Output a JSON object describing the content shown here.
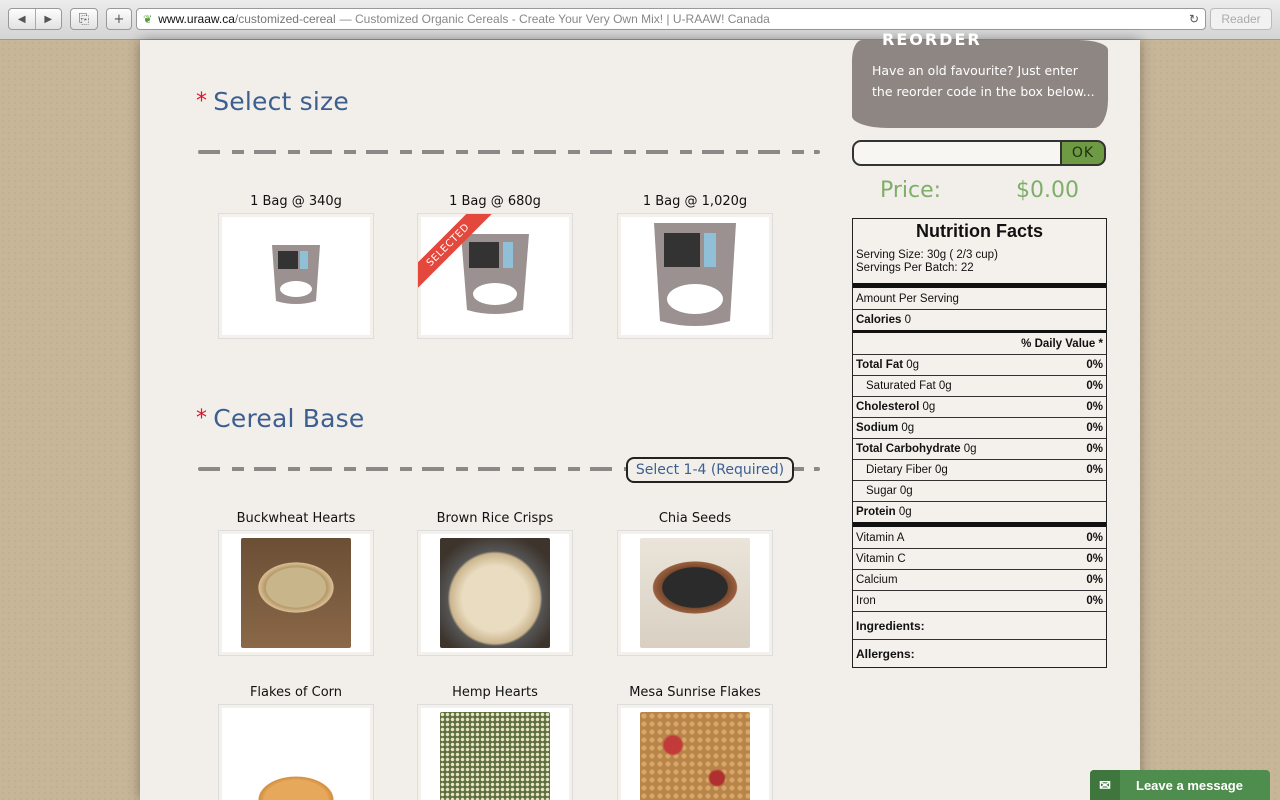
{
  "browser": {
    "url_host": "www.uraaw.ca",
    "url_path": "/customized-cereal",
    "page_title": " — Customized Organic Cereals - Create Your Very Own Mix! | U-RAAW! Canada",
    "reader_label": "Reader",
    "back_glyph": "◀",
    "forward_glyph": "▶",
    "share_glyph": "⎘",
    "add_glyph": "+",
    "reload_glyph": "↻"
  },
  "size_section": {
    "star": "*",
    "title": "Select size",
    "options": [
      {
        "label": "1 Bag @ 340g",
        "selected": false
      },
      {
        "label": "1 Bag @ 680g",
        "selected": true,
        "ribbon": "SELECTED"
      },
      {
        "label": "1 Bag @ 1,020g",
        "selected": false
      }
    ]
  },
  "base_section": {
    "star": "*",
    "title": "Cereal Base",
    "requirement": "Select 1-4 (Required)",
    "items": [
      {
        "label": "Buckwheat Hearts"
      },
      {
        "label": "Brown Rice Crisps"
      },
      {
        "label": "Chia Seeds"
      },
      {
        "label": "Flakes of Corn"
      },
      {
        "label": "Hemp Hearts"
      },
      {
        "label": "Mesa Sunrise Flakes"
      }
    ]
  },
  "reorder": {
    "title": "REORDER",
    "text": "Have an old favourite? Just enter the reorder code in the box below...",
    "input_value": "",
    "ok_label": "OK"
  },
  "price": {
    "label": "Price:",
    "value": "$0.00"
  },
  "nutrition": {
    "title": "Nutrition Facts",
    "serving_size": "Serving Size: 30g ( 2/3 cup)",
    "servings": "Servings Per Batch: 22",
    "amount_per": "Amount Per Serving",
    "calories_label": "Calories",
    "calories_value": "0",
    "daily_value": "% Daily Value *",
    "rows": [
      {
        "label": "Total Fat",
        "amount": "0g",
        "pct": "0%"
      },
      {
        "label": "Saturated Fat",
        "amount": "0g",
        "pct": "0%"
      },
      {
        "label": "Cholesterol",
        "amount": "0g",
        "pct": "0%"
      },
      {
        "label": "Sodium",
        "amount": "0g",
        "pct": "0%"
      },
      {
        "label": "Total Carbohydrate",
        "amount": "0g",
        "pct": "0%"
      },
      {
        "label": "Dietary Fiber",
        "amount": "0g",
        "pct": "0%"
      },
      {
        "label": "Sugar",
        "amount": "0g",
        "pct": ""
      },
      {
        "label": "Protein",
        "amount": "0g",
        "pct": ""
      }
    ],
    "vitamins": [
      {
        "label": "Vitamin A",
        "pct": "0%"
      },
      {
        "label": "Vitamin C",
        "pct": "0%"
      },
      {
        "label": "Calcium",
        "pct": "0%"
      },
      {
        "label": "Iron",
        "pct": "0%"
      }
    ],
    "ingredients_label": "Ingredients:",
    "allergens_label": "Allergens:"
  },
  "chat": {
    "label": "Leave a message",
    "icon": "✉"
  },
  "colors": {
    "accent_blue": "#3d5f90",
    "price_green": "#7fae6a",
    "required_star": "#e0142a",
    "chat_green": "#4e8d4d"
  }
}
